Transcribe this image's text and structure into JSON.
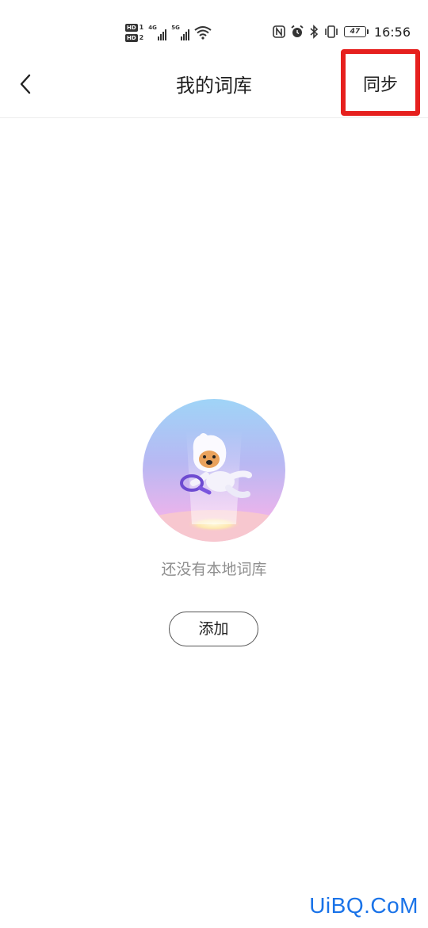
{
  "status_bar": {
    "sim1_label": "HD",
    "sim1_num": "1",
    "sim2_label": "HD",
    "sim2_num": "2",
    "net1_type": "4G",
    "net2_type": "5G",
    "battery_level": "47",
    "time": "16:56",
    "icons": [
      "nfc-icon",
      "alarm-icon",
      "bluetooth-icon",
      "vibrate-icon",
      "wifi-icon"
    ]
  },
  "header": {
    "title": "我的词库",
    "sync_label": "同步",
    "back_icon": "chevron-left-icon",
    "highlight_color": "#e6201e"
  },
  "empty_state": {
    "message": "还没有本地词库",
    "add_label": "添加",
    "illustration": "astronaut-mascot-with-magnifier"
  },
  "watermark": {
    "text": "UiBQ.CoM",
    "color": "#1a73e8"
  }
}
